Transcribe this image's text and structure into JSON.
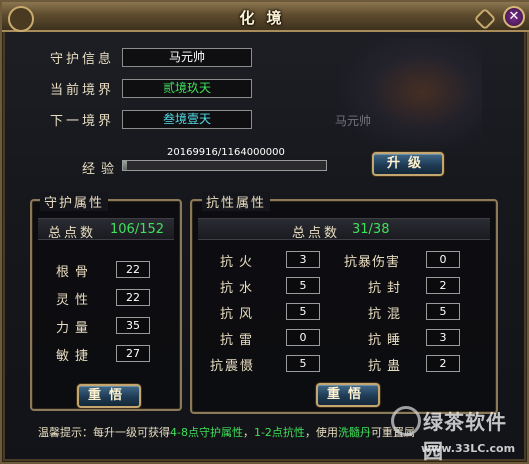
{
  "window": {
    "title": "化境",
    "close_glyph": "✕"
  },
  "info": {
    "guardian_label": "守护信息",
    "guardian_value": "马元帅",
    "current_realm_label": "当前境界",
    "current_realm_value": "贰境玖天",
    "next_realm_label": "下一境界",
    "next_realm_value": "叁境壹天",
    "background_name": "马元帅"
  },
  "experience": {
    "label": "经验",
    "text": "20169916/1164000000",
    "progress_fraction": 0.0173,
    "upgrade_button": "升级"
  },
  "guardian_attributes": {
    "title": "守护属性",
    "total_label": "总点数",
    "total_value": "106/152",
    "stats": [
      {
        "label": "根骨",
        "value": "22"
      },
      {
        "label": "灵性",
        "value": "22"
      },
      {
        "label": "力量",
        "value": "35"
      },
      {
        "label": "敏捷",
        "value": "27"
      }
    ],
    "reset_button": "重悟"
  },
  "resistances": {
    "title": "抗性属性",
    "total_label": "总点数",
    "total_value": "31/38",
    "left": [
      {
        "label": "抗火",
        "value": "3"
      },
      {
        "label": "抗水",
        "value": "5"
      },
      {
        "label": "抗风",
        "value": "5"
      },
      {
        "label": "抗雷",
        "value": "0"
      },
      {
        "label": "抗震慑",
        "value": "5"
      }
    ],
    "right": [
      {
        "label": "抗暴伤害",
        "value": "0"
      },
      {
        "label": "抗封",
        "value": "2"
      },
      {
        "label": "抗混",
        "value": "5"
      },
      {
        "label": "抗睡",
        "value": "3"
      },
      {
        "label": "抗蛊",
        "value": "2"
      }
    ],
    "reset_button": "重悟"
  },
  "tip": {
    "prefix": "温馨提示：每升一级可获得",
    "highlight1": "4-8点守护属性",
    "mid": "，",
    "highlight2": "1-2点抗性",
    "suffix": "，使用",
    "highlight3": "洗髓丹",
    "end": "可重置属"
  },
  "watermark": {
    "text": "绿茶软件园",
    "url": "www.33LC.com"
  },
  "colors": {
    "green": "#3fe05a",
    "cyan": "#55dbe6",
    "gold_border": "#c4a770"
  }
}
